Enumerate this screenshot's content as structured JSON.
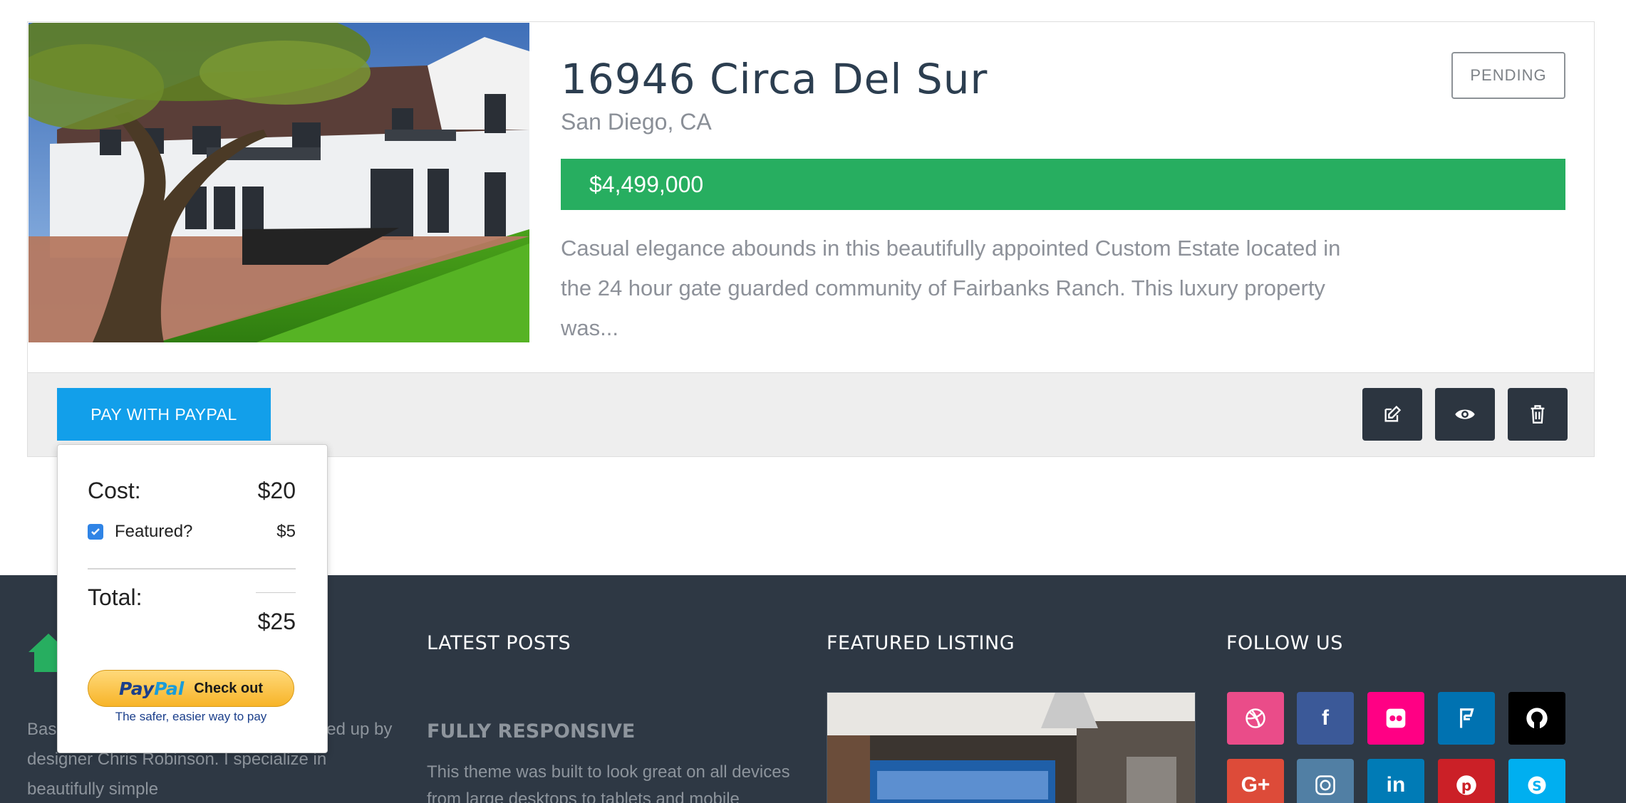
{
  "listing": {
    "title": "16946 Circa Del Sur",
    "location": "San Diego, CA",
    "status": "PENDING",
    "price": "$4,499,000",
    "description": "Casual elegance abounds in this beautifully appointed Custom Estate located in the 24 hour gate guarded community of Fairbanks Ranch. This luxury property was..."
  },
  "actions": {
    "pay_label": "PAY WITH PAYPAL",
    "edit_icon": "edit-icon",
    "view_icon": "eye-icon",
    "delete_icon": "trash-icon"
  },
  "payment_popover": {
    "cost_label": "Cost:",
    "cost_value": "$20",
    "featured_label": "Featured?",
    "featured_checked": true,
    "featured_value": "$5",
    "total_label": "Total:",
    "total_value": "$25",
    "paypal_logo_pay": "Pay",
    "paypal_logo_pal": "Pal",
    "paypal_checkout": "Check out",
    "paypal_tagline": "The safer, easier way to pay"
  },
  "footer": {
    "about_text": "Base is a small web design studio headed up by designer Chris Robinson. I specialize in beautifully simple",
    "latest_posts_heading": "LATEST POSTS",
    "post_title": "FULLY RESPONSIVE",
    "post_text": "This theme was built to look great on all devices from large desktops to tablets and mobile",
    "featured_heading": "FEATURED LISTING",
    "follow_heading": "FOLLOW US",
    "social": [
      {
        "name": "dribbble",
        "glyph": "◎",
        "color": "#ea4c89"
      },
      {
        "name": "facebook",
        "glyph": "f",
        "color": "#3b5998"
      },
      {
        "name": "flickr",
        "glyph": "●●",
        "color": "#ff0084"
      },
      {
        "name": "foursquare",
        "glyph": "F",
        "color": "#0072b1"
      },
      {
        "name": "github",
        "glyph": "◉",
        "color": "#000000"
      },
      {
        "name": "google-plus",
        "glyph": "G+",
        "color": "#dd4b39"
      },
      {
        "name": "instagram",
        "glyph": "▣",
        "color": "#517fa4"
      },
      {
        "name": "linkedin",
        "glyph": "in",
        "color": "#007bb6"
      },
      {
        "name": "pinterest",
        "glyph": "P",
        "color": "#cb2027"
      },
      {
        "name": "skype",
        "glyph": "S",
        "color": "#00aff0"
      }
    ]
  },
  "colors": {
    "price_bar": "#27ae60",
    "paypal_button": "#129fea",
    "footer_bg": "#2e3844",
    "action_button": "#2c3540"
  }
}
